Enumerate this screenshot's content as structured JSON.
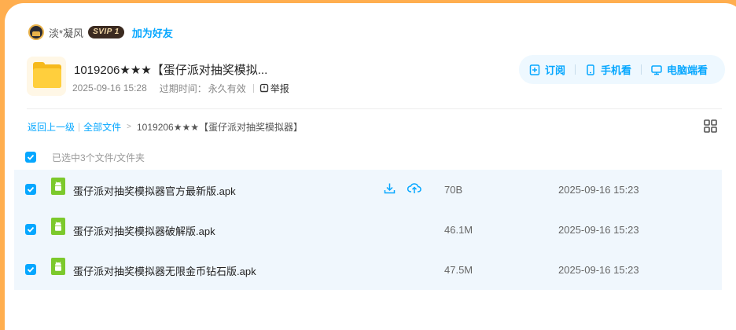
{
  "user": {
    "name": "淡*凝风",
    "vip_badge": "SVIP 1",
    "add_friend": "加为好友"
  },
  "share": {
    "title": "1019206★★★【蛋仔派对抽奖模拟...",
    "date": "2025-09-16 15:28",
    "expire_label": "过期时间：",
    "expire_value": "永久有效",
    "report_label": "举报"
  },
  "actions": {
    "subscribe": "订阅",
    "mobile_view": "手机看",
    "pc_view": "电脑端看"
  },
  "breadcrumb": {
    "back": "返回上一级",
    "all_files": "全部文件",
    "current": "1019206★★★【蛋仔派对抽奖模拟器】"
  },
  "selection": {
    "text": "已选中3个文件/文件夹"
  },
  "files": [
    {
      "name": "蛋仔派对抽奖模拟器官方最新版.apk",
      "size": "70B",
      "date": "2025-09-16 15:23"
    },
    {
      "name": "蛋仔派对抽奖模拟器破解版.apk",
      "size": "46.1M",
      "date": "2025-09-16 15:23"
    },
    {
      "name": "蛋仔派对抽奖模拟器无限金币钻石版.apk",
      "size": "47.5M",
      "date": "2025-09-16 15:23"
    }
  ],
  "colors": {
    "accent": "#06a7ff",
    "page_background": "#ffae4f",
    "row_background": "#f0f7fd",
    "android_green": "#7cc92c"
  }
}
